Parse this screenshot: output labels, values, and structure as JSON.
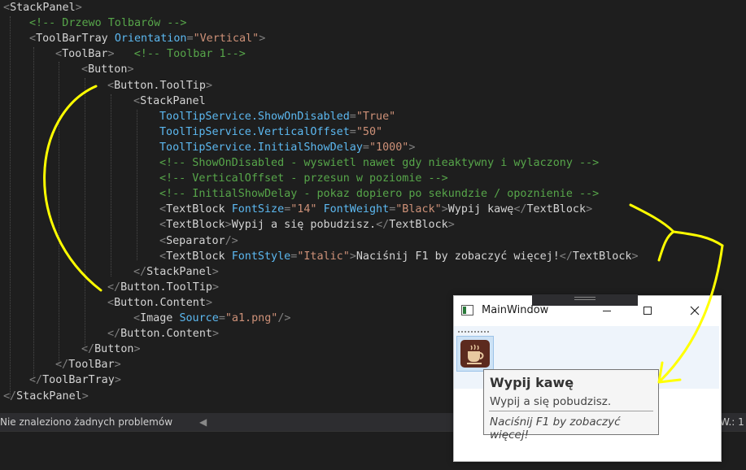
{
  "editor": {
    "lines": [
      {
        "indent": 0,
        "tokens": [
          [
            "punct",
            "<"
          ],
          [
            "tag",
            "StackPanel"
          ],
          [
            "punct",
            ">"
          ]
        ]
      },
      {
        "indent": 1,
        "tokens": [
          [
            "comment",
            "<!-- Drzewo Tolbarów -->"
          ]
        ]
      },
      {
        "indent": 1,
        "tokens": [
          [
            "punct",
            "<"
          ],
          [
            "tag",
            "ToolBarTray "
          ],
          [
            "attr",
            "Orientation"
          ],
          [
            "punct",
            "="
          ],
          [
            "val",
            "\"Vertical\""
          ],
          [
            "punct",
            ">"
          ]
        ]
      },
      {
        "indent": 2,
        "tokens": [
          [
            "punct",
            "<"
          ],
          [
            "tag",
            "ToolBar"
          ],
          [
            "punct",
            ">"
          ],
          [
            "text",
            "   "
          ],
          [
            "comment",
            "<!-- Toolbar 1-->"
          ]
        ]
      },
      {
        "indent": 3,
        "tokens": [
          [
            "punct",
            "<"
          ],
          [
            "tag",
            "Button"
          ],
          [
            "punct",
            ">"
          ]
        ]
      },
      {
        "indent": 4,
        "tokens": [
          [
            "punct",
            "<"
          ],
          [
            "tag",
            "Button.ToolTip"
          ],
          [
            "punct",
            ">"
          ]
        ]
      },
      {
        "indent": 5,
        "tokens": [
          [
            "punct",
            "<"
          ],
          [
            "tag",
            "StackPanel"
          ]
        ]
      },
      {
        "indent": 6,
        "tokens": [
          [
            "attr",
            "ToolTipService.ShowOnDisabled"
          ],
          [
            "punct",
            "="
          ],
          [
            "val",
            "\"True\""
          ]
        ]
      },
      {
        "indent": 6,
        "tokens": [
          [
            "attr",
            "ToolTipService.VerticalOffset"
          ],
          [
            "punct",
            "="
          ],
          [
            "val",
            "\"50\""
          ]
        ]
      },
      {
        "indent": 6,
        "tokens": [
          [
            "attr",
            "ToolTipService.InitialShowDelay"
          ],
          [
            "punct",
            "="
          ],
          [
            "val",
            "\"1000\""
          ],
          [
            "punct",
            ">"
          ]
        ]
      },
      {
        "indent": 6,
        "tokens": [
          [
            "comment",
            "<!-- ShowOnDisabled - wyswietl nawet gdy nieaktywny i wylaczony -->"
          ]
        ]
      },
      {
        "indent": 6,
        "tokens": [
          [
            "comment",
            "<!-- VerticalOffset - przesun w poziomie -->"
          ]
        ]
      },
      {
        "indent": 6,
        "tokens": [
          [
            "comment",
            "<!-- InitialShowDelay - pokaz dopiero po sekundzie / opoznienie -->"
          ]
        ]
      },
      {
        "indent": 6,
        "tokens": [
          [
            "punct",
            "<"
          ],
          [
            "tag",
            "TextBlock "
          ],
          [
            "attr",
            "FontSize"
          ],
          [
            "punct",
            "="
          ],
          [
            "val",
            "\"14\" "
          ],
          [
            "attr",
            "FontWeight"
          ],
          [
            "punct",
            "="
          ],
          [
            "val",
            "\"Black\""
          ],
          [
            "punct",
            ">"
          ],
          [
            "text",
            "Wypij kawę"
          ],
          [
            "punct",
            "</"
          ],
          [
            "tag",
            "TextBlock"
          ],
          [
            "punct",
            ">"
          ]
        ]
      },
      {
        "indent": 6,
        "tokens": [
          [
            "punct",
            "<"
          ],
          [
            "tag",
            "TextBlock"
          ],
          [
            "punct",
            ">"
          ],
          [
            "text",
            "Wypij a się pobudzisz."
          ],
          [
            "punct",
            "</"
          ],
          [
            "tag",
            "TextBlock"
          ],
          [
            "punct",
            ">"
          ]
        ]
      },
      {
        "indent": 6,
        "tokens": [
          [
            "punct",
            "<"
          ],
          [
            "tag",
            "Separator"
          ],
          [
            "punct",
            "/>"
          ]
        ]
      },
      {
        "indent": 6,
        "tokens": [
          [
            "punct",
            "<"
          ],
          [
            "tag",
            "TextBlock "
          ],
          [
            "attr",
            "FontStyle"
          ],
          [
            "punct",
            "="
          ],
          [
            "val",
            "\"Italic\""
          ],
          [
            "punct",
            ">"
          ],
          [
            "text",
            "Naciśnij F1 by zobaczyć więcej!"
          ],
          [
            "punct",
            "</"
          ],
          [
            "tag",
            "TextBlock"
          ],
          [
            "punct",
            ">"
          ]
        ]
      },
      {
        "indent": 5,
        "tokens": [
          [
            "punct",
            "</"
          ],
          [
            "tag",
            "StackPanel"
          ],
          [
            "punct",
            ">"
          ]
        ]
      },
      {
        "indent": 4,
        "tokens": [
          [
            "punct",
            "</"
          ],
          [
            "tag",
            "Button.ToolTip"
          ],
          [
            "punct",
            ">"
          ]
        ]
      },
      {
        "indent": 4,
        "tokens": [
          [
            "punct",
            "<"
          ],
          [
            "tag",
            "Button.Content"
          ],
          [
            "punct",
            ">"
          ]
        ]
      },
      {
        "indent": 5,
        "tokens": [
          [
            "punct",
            "<"
          ],
          [
            "tag",
            "Image "
          ],
          [
            "attr",
            "Source"
          ],
          [
            "punct",
            "="
          ],
          [
            "val",
            "\"a1.png\""
          ],
          [
            "punct",
            "/>"
          ]
        ]
      },
      {
        "indent": 4,
        "tokens": [
          [
            "punct",
            "</"
          ],
          [
            "tag",
            "Button.Content"
          ],
          [
            "punct",
            ">"
          ]
        ]
      },
      {
        "indent": 3,
        "tokens": [
          [
            "punct",
            "</"
          ],
          [
            "tag",
            "Button"
          ],
          [
            "punct",
            ">"
          ]
        ]
      },
      {
        "indent": 2,
        "tokens": [
          [
            "punct",
            "</"
          ],
          [
            "tag",
            "ToolBar"
          ],
          [
            "punct",
            ">"
          ]
        ]
      },
      {
        "indent": 1,
        "tokens": [
          [
            "punct",
            "</"
          ],
          [
            "tag",
            "ToolBarTray"
          ],
          [
            "punct",
            ">"
          ]
        ]
      },
      {
        "indent": 0,
        "tokens": [
          [
            "punct",
            "</"
          ],
          [
            "tag",
            "StackPanel"
          ],
          [
            "punct",
            ">"
          ]
        ]
      }
    ]
  },
  "statusbar": {
    "problems": "Nie znaleziono żadnych problemów",
    "right_text": "W.: 1"
  },
  "window": {
    "title": "MainWindow",
    "icon": "window-app-icon",
    "minimize_label": "—",
    "maximize_label": "☐",
    "close_label": "✕"
  },
  "tooltip": {
    "title": "Wypij kawę",
    "subtitle": "Wypij a się pobudzisz.",
    "hint": "Naciśnij F1 by zobaczyć więcej!"
  },
  "colors": {
    "annotation": "#ffff00",
    "editor_bg": "#1e1e1e",
    "comment": "#57a64a",
    "attribute": "#5cb8f0",
    "value": "#ce9178"
  }
}
